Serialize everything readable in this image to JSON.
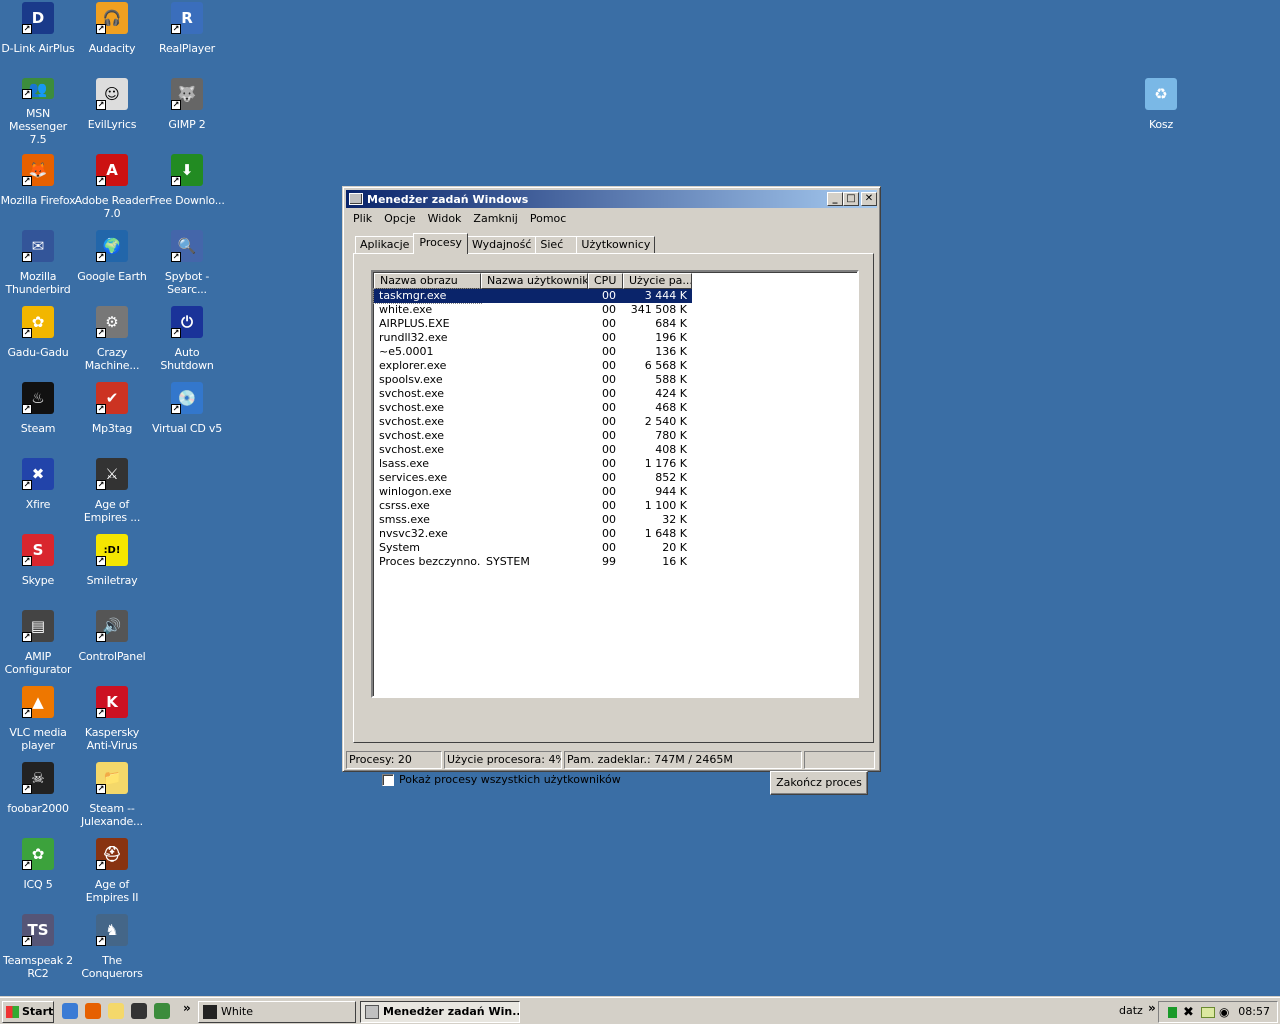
{
  "desktop": {
    "icons": [
      {
        "label": "D-Link AirPlus",
        "icon": "dlink-icon",
        "color": "#1a3a8a",
        "glyph": "D"
      },
      {
        "label": "Audacity",
        "icon": "audacity-icon",
        "color": "#f0a020",
        "glyph": "🎧"
      },
      {
        "label": "RealPlayer",
        "icon": "realplayer-icon",
        "color": "#3a6ebc",
        "glyph": "R"
      },
      {
        "label": "MSN Messenger 7.5",
        "icon": "msn-icon",
        "color": "#3c8c3c",
        "glyph": "👥"
      },
      {
        "label": "EvilLyrics",
        "icon": "evillyrics-icon",
        "color": "#dddddd",
        "glyph": "☺"
      },
      {
        "label": "GIMP 2",
        "icon": "gimp-icon",
        "color": "#666666",
        "glyph": "🐺"
      },
      {
        "label": "Mozilla Firefox",
        "icon": "firefox-icon",
        "color": "#e66000",
        "glyph": "🦊"
      },
      {
        "label": "Adobe Reader 7.0",
        "icon": "adobe-reader-icon",
        "color": "#cc1111",
        "glyph": "A"
      },
      {
        "label": "Free Downlo...",
        "icon": "free-download-icon",
        "color": "#228b22",
        "glyph": "⬇"
      },
      {
        "label": "Mozilla Thunderbird",
        "icon": "thunderbird-icon",
        "color": "#335599",
        "glyph": "✉"
      },
      {
        "label": "Google Earth",
        "icon": "google-earth-icon",
        "color": "#2266aa",
        "glyph": "🌍"
      },
      {
        "label": "Spybot - Searc...",
        "icon": "spybot-icon",
        "color": "#4466aa",
        "glyph": "🔍"
      },
      {
        "label": "Gadu-Gadu",
        "icon": "gadu-gadu-icon",
        "color": "#f2b600",
        "glyph": "✿"
      },
      {
        "label": "Crazy Machine...",
        "icon": "crazy-machines-icon",
        "color": "#777777",
        "glyph": "⚙"
      },
      {
        "label": "Auto Shutdown",
        "icon": "auto-shutdown-icon",
        "color": "#1a3399",
        "glyph": "⏻"
      },
      {
        "label": "Steam",
        "icon": "steam-icon",
        "color": "#111111",
        "glyph": "♨"
      },
      {
        "label": "Mp3tag",
        "icon": "mp3tag-icon",
        "color": "#cc3322",
        "glyph": "✔"
      },
      {
        "label": "Virtual CD v5",
        "icon": "virtual-cd-icon",
        "color": "#3377cc",
        "glyph": "💿"
      },
      {
        "label": "Xfire",
        "icon": "xfire-icon",
        "color": "#2244aa",
        "glyph": "✖"
      },
      {
        "label": "Age of Empires ...",
        "icon": "age-of-empires-icon",
        "color": "#333333",
        "glyph": "⚔"
      },
      {
        "label": "Skype",
        "icon": "skype-icon",
        "color": "#d9262e",
        "glyph": "S"
      },
      {
        "label": "Smiletray",
        "icon": "smiletray-icon",
        "color": "#f5e600",
        "glyph": ":D!"
      },
      {
        "label": "AMIP Configurator",
        "icon": "amip-icon",
        "color": "#444444",
        "glyph": "▤"
      },
      {
        "label": "ControlPanel",
        "icon": "control-panel-icon",
        "color": "#555555",
        "glyph": "🔊"
      },
      {
        "label": "VLC media player",
        "icon": "vlc-icon",
        "color": "#ee7700",
        "glyph": "▲"
      },
      {
        "label": "Kaspersky Anti-Virus",
        "icon": "kaspersky-icon",
        "color": "#cc1122",
        "glyph": "K"
      },
      {
        "label": "foobar2000",
        "icon": "foobar-icon",
        "color": "#222222",
        "glyph": "☠"
      },
      {
        "label": "Steam -- Julexande...",
        "icon": "folder-icon",
        "color": "#f4d86a",
        "glyph": "📁"
      },
      {
        "label": "ICQ 5",
        "icon": "icq-icon",
        "color": "#3ca23c",
        "glyph": "✿"
      },
      {
        "label": "Age of Empires II",
        "icon": "age-of-empires-2-icon",
        "color": "#883311",
        "glyph": "⛑"
      },
      {
        "label": "Teamspeak 2 RC2",
        "icon": "teamspeak-icon",
        "color": "#555577",
        "glyph": "TS"
      },
      {
        "label": "The Conquerors",
        "icon": "conquerors-icon",
        "color": "#446688",
        "glyph": "♞"
      },
      {
        "label": "Kosz",
        "icon": "recycle-bin-icon",
        "color": "#7ab8e6",
        "glyph": "♻"
      }
    ]
  },
  "window": {
    "title": "Menedżer zadań Windows",
    "menu": [
      "Plik",
      "Opcje",
      "Widok",
      "Zamknij",
      "Pomoc"
    ],
    "tabs": [
      "Aplikacje",
      "Procesy",
      "Wydajność",
      "Sieć",
      "Użytkownicy"
    ],
    "active_tab": "Procesy",
    "columns": [
      "Nazwa obrazu",
      "Nazwa użytkownika",
      "CPU",
      "Użycie pa..."
    ],
    "processes": [
      {
        "name": "taskmgr.exe",
        "user": "",
        "cpu": "00",
        "mem": "3 444 K"
      },
      {
        "name": "white.exe",
        "user": "",
        "cpu": "00",
        "mem": "341 508 K"
      },
      {
        "name": "AIRPLUS.EXE",
        "user": "",
        "cpu": "00",
        "mem": "684 K"
      },
      {
        "name": "rundll32.exe",
        "user": "",
        "cpu": "00",
        "mem": "196 K"
      },
      {
        "name": "~e5.0001",
        "user": "",
        "cpu": "00",
        "mem": "136 K"
      },
      {
        "name": "explorer.exe",
        "user": "",
        "cpu": "00",
        "mem": "6 568 K"
      },
      {
        "name": "spoolsv.exe",
        "user": "",
        "cpu": "00",
        "mem": "588 K"
      },
      {
        "name": "svchost.exe",
        "user": "",
        "cpu": "00",
        "mem": "424 K"
      },
      {
        "name": "svchost.exe",
        "user": "",
        "cpu": "00",
        "mem": "468 K"
      },
      {
        "name": "svchost.exe",
        "user": "",
        "cpu": "00",
        "mem": "2 540 K"
      },
      {
        "name": "svchost.exe",
        "user": "",
        "cpu": "00",
        "mem": "780 K"
      },
      {
        "name": "svchost.exe",
        "user": "",
        "cpu": "00",
        "mem": "408 K"
      },
      {
        "name": "lsass.exe",
        "user": "",
        "cpu": "00",
        "mem": "1 176 K"
      },
      {
        "name": "services.exe",
        "user": "",
        "cpu": "00",
        "mem": "852 K"
      },
      {
        "name": "winlogon.exe",
        "user": "",
        "cpu": "00",
        "mem": "944 K"
      },
      {
        "name": "csrss.exe",
        "user": "",
        "cpu": "00",
        "mem": "1 100 K"
      },
      {
        "name": "smss.exe",
        "user": "",
        "cpu": "00",
        "mem": "32 K"
      },
      {
        "name": "nvsvc32.exe",
        "user": "",
        "cpu": "00",
        "mem": "1 648 K"
      },
      {
        "name": "System",
        "user": "",
        "cpu": "00",
        "mem": "20 K"
      },
      {
        "name": "Proces bezczynno...",
        "user": "SYSTEM",
        "cpu": "99",
        "mem": "16 K"
      }
    ],
    "show_all_label": "Pokaż procesy wszystkich użytkowników",
    "show_all_checked": false,
    "end_process_label": "Zakończ proces",
    "status": {
      "processes": "Procesy: 20",
      "cpu": "Użycie procesora: 4%",
      "commit": "Pam. zadeklar.: 747M / 2465M"
    }
  },
  "taskbar": {
    "start_label": "Start",
    "overflow": "»",
    "quick_launch": [
      {
        "icon": "ie-icon",
        "color": "#3a7bd5"
      },
      {
        "icon": "firefox-icon",
        "color": "#e66000"
      },
      {
        "icon": "folder-icon",
        "color": "#f4d86a"
      },
      {
        "icon": "foobar-icon",
        "color": "#333333"
      },
      {
        "icon": "msn-icon",
        "color": "#3c8c3c"
      }
    ],
    "tasks": [
      {
        "label": "White",
        "icon": "white-app-icon",
        "active": false
      },
      {
        "label": "Menedżer zadań Win...",
        "icon": "taskmgr-icon",
        "active": true
      }
    ],
    "user_label": "datz",
    "clock": "08:57"
  }
}
